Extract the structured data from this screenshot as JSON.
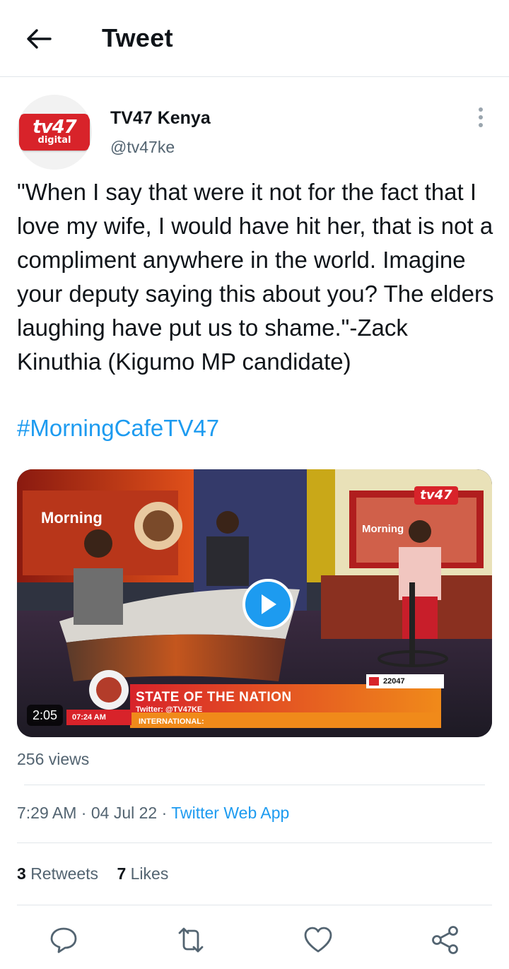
{
  "header": {
    "title": "Tweet",
    "back_icon": "arrow-left-icon"
  },
  "author": {
    "name": "TV47 Kenya",
    "handle": "@tv47ke",
    "avatar_logo_text": "tv47",
    "avatar_logo_subtext": "digital"
  },
  "more_icon": "more-vertical-icon",
  "tweet": {
    "text": "\"When I say that were it not for the fact that I love my wife, I would have hit her, that is not a compliment anywhere in the world. Imagine your deputy saying this about you? The elders laughing have put us to shame.\"-Zack Kinuthia (Kigumo MP candidate)",
    "hashtag": "#MorningCafeTV47"
  },
  "media": {
    "duration": "2:05",
    "play_icon": "play-icon",
    "overlay": {
      "channel_logo": "tv47",
      "set_brand": "Morning",
      "set_brand_secondary": "Morning",
      "title": "STATE OF THE NATION",
      "twitter": "Twitter: @TV47KE",
      "ticker_label": "INTERNATIONAL:",
      "clock": "07:24 AM",
      "sms_number": "22047"
    }
  },
  "views": "256 views",
  "meta": {
    "time": "7:29 AM",
    "separator": " · ",
    "date": "04 Jul 22",
    "source": "Twitter Web App"
  },
  "stats": {
    "retweets_count": "3",
    "retweets_label": "Retweets",
    "likes_count": "7",
    "likes_label": "Likes"
  },
  "actions": [
    {
      "name": "reply",
      "icon": "reply-icon"
    },
    {
      "name": "retweet",
      "icon": "retweet-icon"
    },
    {
      "name": "like",
      "icon": "heart-icon"
    },
    {
      "name": "share",
      "icon": "share-icon"
    }
  ],
  "colors": {
    "accent": "#1d9bf0",
    "text_primary": "#0f1419",
    "text_secondary": "#536471",
    "brand_red": "#d8232a",
    "divider": "#e1e6ea"
  }
}
